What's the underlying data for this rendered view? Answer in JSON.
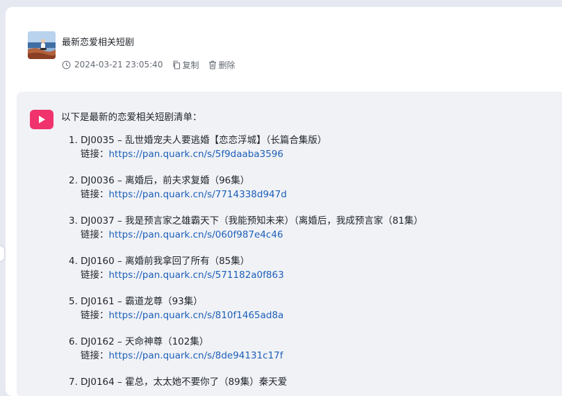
{
  "user_message": {
    "text": "最新恋爱相关短剧",
    "timestamp": "2024-03-21 23:05:40",
    "copy_label": "复制",
    "delete_label": "删除",
    "icons": {
      "time": "clock-icon",
      "copy": "copy-icon",
      "delete": "trash-icon"
    }
  },
  "answer": {
    "bot_icon": "play-icon",
    "intro": "以下是最新的恋爱相关短剧清单：",
    "link_label": "链接：",
    "items": [
      {
        "num": "1.",
        "title": "DJ0035 – 乱世婚宠夫人要逃婚【恋恋浮城】（长篇合集版）",
        "url": "https://pan.quark.cn/s/5f9daaba3596"
      },
      {
        "num": "2.",
        "title": "DJ0036 – 离婚后，前夫求复婚（96集）",
        "url": "https://pan.quark.cn/s/7714338d947d"
      },
      {
        "num": "3.",
        "title": "DJ0037 – 我是预言家之雄霸天下（我能预知未来）（离婚后，我成预言家（81集）",
        "url": "https://pan.quark.cn/s/060f987e4c46"
      },
      {
        "num": "4.",
        "title": "DJ0160 – 离婚前我拿回了所有（85集）",
        "url": "https://pan.quark.cn/s/571182a0f863"
      },
      {
        "num": "5.",
        "title": "DJ0161 – 霸道龙尊（93集）",
        "url": "https://pan.quark.cn/s/810f1465ad8a"
      },
      {
        "num": "6.",
        "title": "DJ0162 – 天命神尊（102集）",
        "url": "https://pan.quark.cn/s/8de94131c17f"
      },
      {
        "num": "7.",
        "title": "DJ0164 – 霍总，太太她不要你了（89集）秦天爱",
        "url": ""
      }
    ]
  },
  "colors": {
    "background": "#e6e9f1",
    "panel": "#f0f2f6",
    "accent": "#f0336d",
    "link": "#1d5fb8"
  }
}
